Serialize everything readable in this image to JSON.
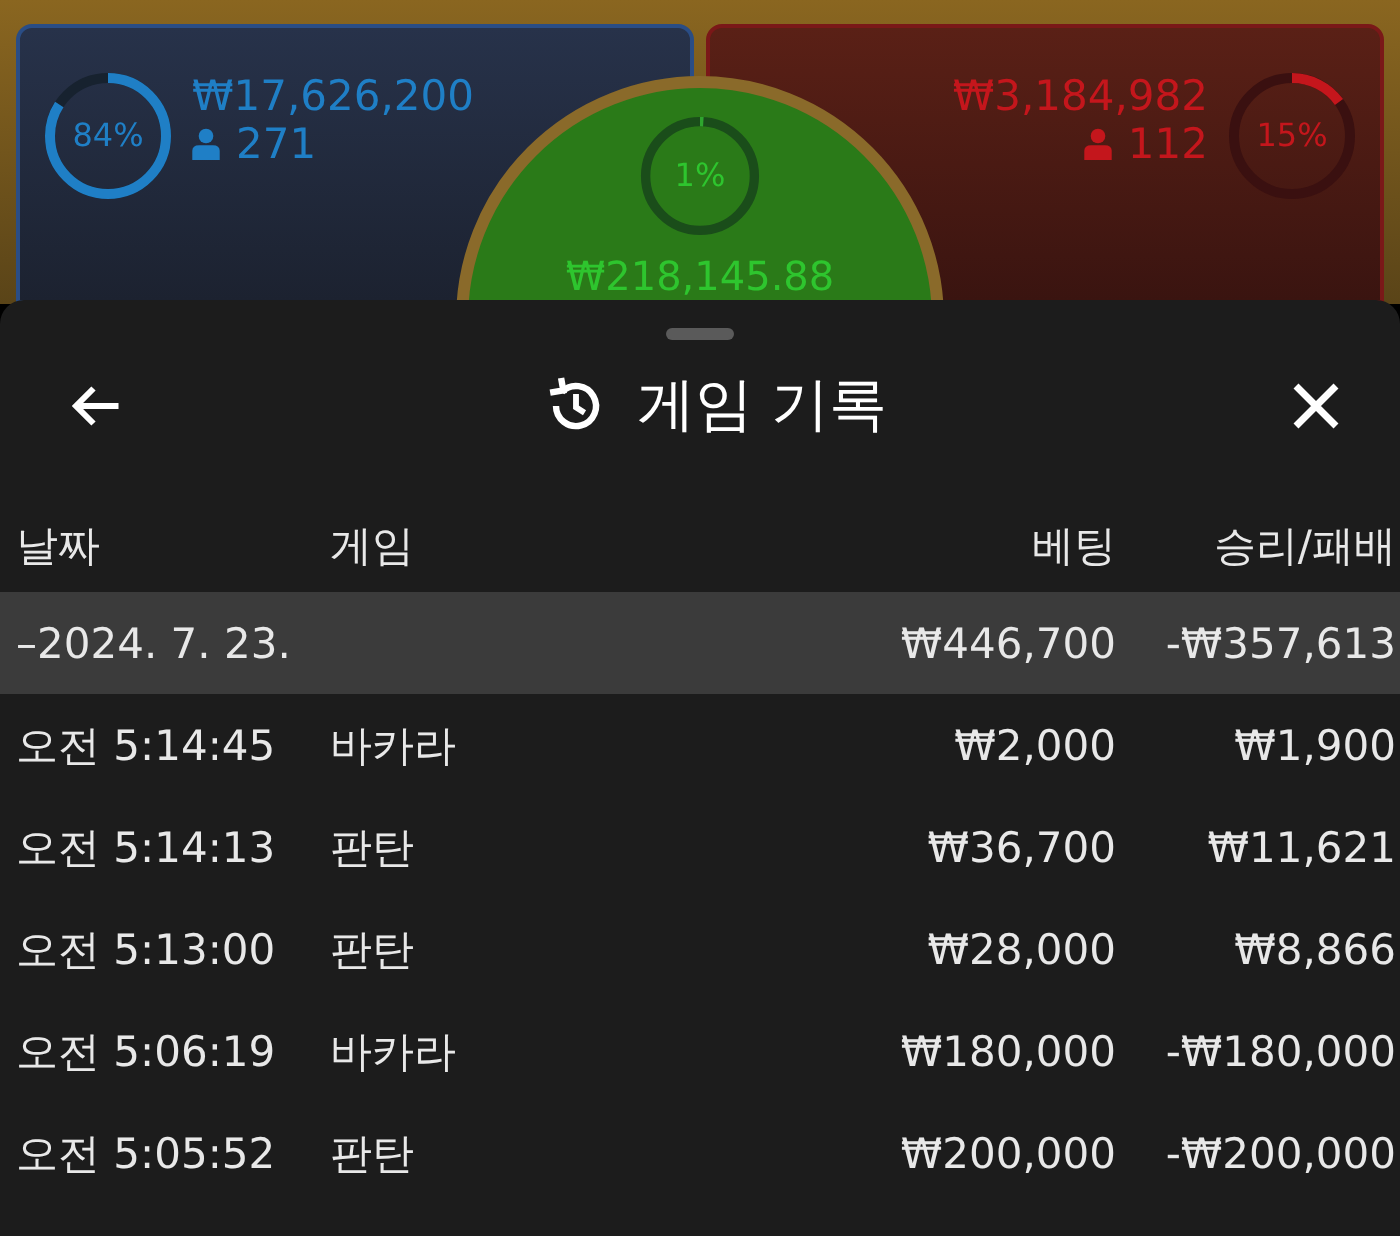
{
  "bets": [
    {
      "kind": "player",
      "share": "84%",
      "level": 0.84,
      "amount": "₩17,626,200",
      "players": "271"
    },
    {
      "kind": "tie",
      "share": "1%",
      "level": 0.01,
      "amount": "₩218,145.88"
    },
    {
      "kind": "banker",
      "share": "15%",
      "level": 0.15,
      "amount": "₩3,184,982",
      "players": "112"
    }
  ],
  "modal": {
    "title": "게임 기록",
    "columns": [
      "날짜",
      "게임",
      "베팅",
      "승리/패배"
    ],
    "groups": [
      {
        "date": "–2024. 7. 23.",
        "bet": "₩446,700",
        "result": "-₩357,613",
        "rows": [
          {
            "time": "오전 5:14:45",
            "game": "바카라",
            "bet": "₩2,000",
            "result": "₩1,900"
          },
          {
            "time": "오전 5:14:13",
            "game": "판탄",
            "bet": "₩36,700",
            "result": "₩11,621"
          },
          {
            "time": "오전 5:13:00",
            "game": "판탄",
            "bet": "₩28,000",
            "result": "₩8,866"
          },
          {
            "time": "오전 5:06:19",
            "game": "바카라",
            "bet": "₩180,000",
            "result": "-₩180,000"
          },
          {
            "time": "오전 5:05:52",
            "game": "판탄",
            "bet": "₩200,000",
            "result": "-₩200,000"
          }
        ]
      }
    ]
  }
}
